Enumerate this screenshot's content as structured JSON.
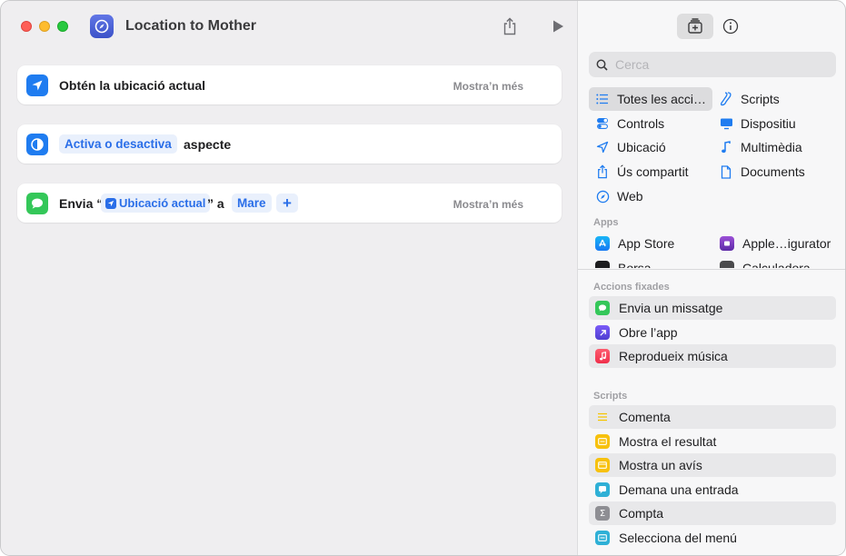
{
  "window": {
    "title": "Location to Mother"
  },
  "actions": [
    {
      "label": "Obtén la ubicació actual",
      "more": "Mostra’n més"
    },
    {
      "token": "Activa o desactiva",
      "label": "aspecte"
    },
    {
      "prefix": "Envia “",
      "variable": "Ubicació actual",
      "middle": "” a",
      "recipient": "Mare",
      "plus": "+",
      "more": "Mostra’n més"
    }
  ],
  "library": {
    "search_placeholder": "Cerca",
    "categories_left": [
      "Totes les acci…",
      "Controls",
      "Ubicació",
      "Ús compartit",
      "Web"
    ],
    "categories_right": [
      "Scripts",
      "Dispositiu",
      "Multimèdia",
      "Documents"
    ],
    "apps_heading": "Apps",
    "apps": [
      "App Store",
      "Apple…igurator",
      "Borsa",
      "Calculadora"
    ],
    "pinned_heading": "Accions fixades",
    "pinned": [
      "Envia un missatge",
      "Obre l’app",
      "Reprodueix música"
    ],
    "scripts_heading": "Scripts",
    "scripts": [
      "Comenta",
      "Mostra el resultat",
      "Mostra un avís",
      "Demana una entrada",
      "Compta",
      "Selecciona del menú"
    ]
  },
  "colors": {
    "accent": "#2a6ee8",
    "messages": "#34c759",
    "location": "#1f7cf0"
  }
}
